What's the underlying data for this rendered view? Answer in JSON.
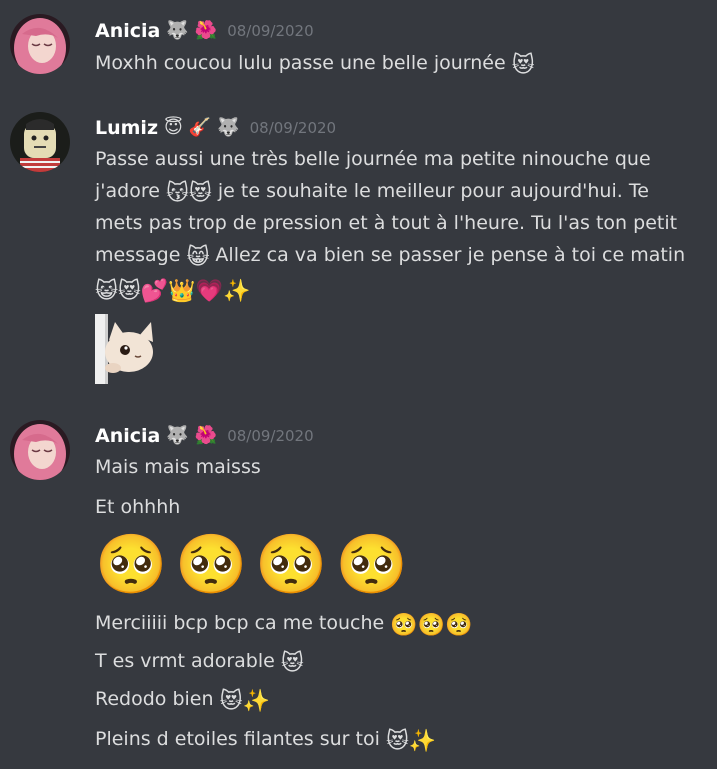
{
  "messages": [
    {
      "author": "Anicia",
      "badges": [
        "🐺",
        "🌺"
      ],
      "timestamp": "08/09/2020",
      "lines": [
        {
          "text": "Moxhh coucou lulu passe une belle journée",
          "emoji": "😻"
        }
      ]
    },
    {
      "author": "Lumiz",
      "badges": [
        "😇",
        "🎸",
        "🐺"
      ],
      "timestamp": "08/09/2020",
      "lines": [
        {
          "text": "Passe aussi une très belle journée ma petite ninouche que"
        },
        {
          "pre": "j'adore",
          "emoji": "😽😻",
          "text": "je te souhaite le meilleur pour aujourd'hui. Te"
        },
        {
          "text": "mets pas trop de pression et à tout à l'heure. Tu l'as ton petit"
        },
        {
          "pre": "message",
          "emoji": "😸",
          "text": "Allez ca va bien se passer je pense à toi ce matin"
        },
        {
          "emoji": "😺😻💕👑💗✨"
        }
      ],
      "sticker": "peeking-cat"
    },
    {
      "author": "Anicia",
      "badges": [
        "🐺",
        "🌺"
      ],
      "timestamp": "08/09/2020",
      "lines": [
        {
          "text": "Mais mais maisss"
        },
        {
          "text": "Et ohhhh"
        },
        {
          "big_emoji": "🥺🥺🥺🥺"
        },
        {
          "text": "Merciiiii bcp bcp ca me touche",
          "emoji": "🥺🥺🥺"
        },
        {
          "text": "T es vrmt adorable",
          "emoji": "😻"
        },
        {
          "text": "Redodo bien",
          "emoji": "😻✨"
        },
        {
          "text": "Pleins d etoiles filantes sur toi",
          "emoji": "😻✨"
        }
      ]
    }
  ],
  "colors": {
    "background": "#36393f",
    "username": "#ffffff",
    "text": "#dcddde",
    "timestamp": "#72767d"
  }
}
